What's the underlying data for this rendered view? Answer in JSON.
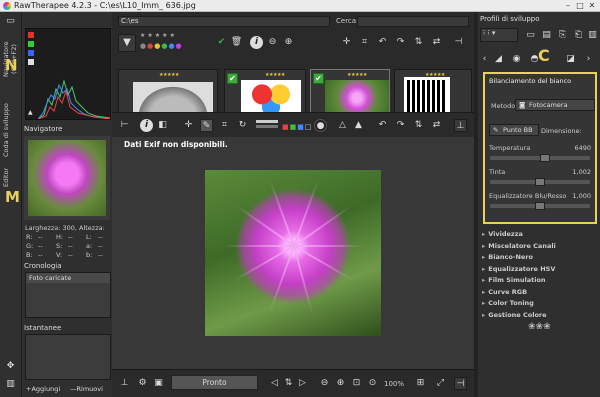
{
  "window": {
    "title": "RawTherapee 4.2.3 - C:\\es\\L10_Imm_ 636.jpg"
  },
  "left_tabs": {
    "navigator": "Navigatore (Ctrl+F2)",
    "queue": "Coda di sviluppo",
    "editor": "Editor",
    "letter_n": "N",
    "letter_m": "M"
  },
  "left_panel": {
    "navigator_title": "Navigatore",
    "nav_info": {
      "width_label": "Larghezza: 300, Altezza:",
      "r": "R:",
      "g": "G:",
      "b": "B:",
      "h": "H:",
      "s": "S:",
      "v": "V:",
      "l": "L:",
      "a": "a:",
      "bb": "b:",
      "dash": "--"
    },
    "history_title": "Cronologia",
    "history_items": [
      "Foto caricate"
    ],
    "snapshots_title": "Istantanee",
    "add_label": "Aggiungi",
    "remove_label": "Rimuovi"
  },
  "filebrowser": {
    "path": "C:\\es",
    "search_label": "Cerca:",
    "search_value": "",
    "stars": "★★★★★"
  },
  "viewer": {
    "exif_message": "Dati Exif non disponibili.",
    "status_label": "Pronto",
    "zoom": "100%"
  },
  "right_panel": {
    "profiles_label": "Profili di sviluppo",
    "letter_c": "C",
    "wb_title": "Bilanciamento del bianco",
    "method_label": "Metodo",
    "method_value": "Fotocamera",
    "spot_label": "Punto BB",
    "size_label": "Dimensione:",
    "temp_label": "Temperatura",
    "temp_value": "6490",
    "temp_fraction": 0.55,
    "tint_label": "Tinta",
    "tint_value": "1,002",
    "tint_fraction": 0.5,
    "equal_label": "Equalizzatore Blu/Rosso",
    "equal_value": "1,000",
    "equal_fraction": 0.5,
    "tools": [
      "Vividezza",
      "Miscelatore Canali",
      "Bianco-Nero",
      "Equalizzatore HSV",
      "Film Simulation",
      "Curve RGB",
      "Color Toning",
      "Gestione Colore"
    ]
  },
  "colors": {
    "highlight": "#e8d25a",
    "check": "#3fa83f",
    "flower": "#d24fd6"
  }
}
